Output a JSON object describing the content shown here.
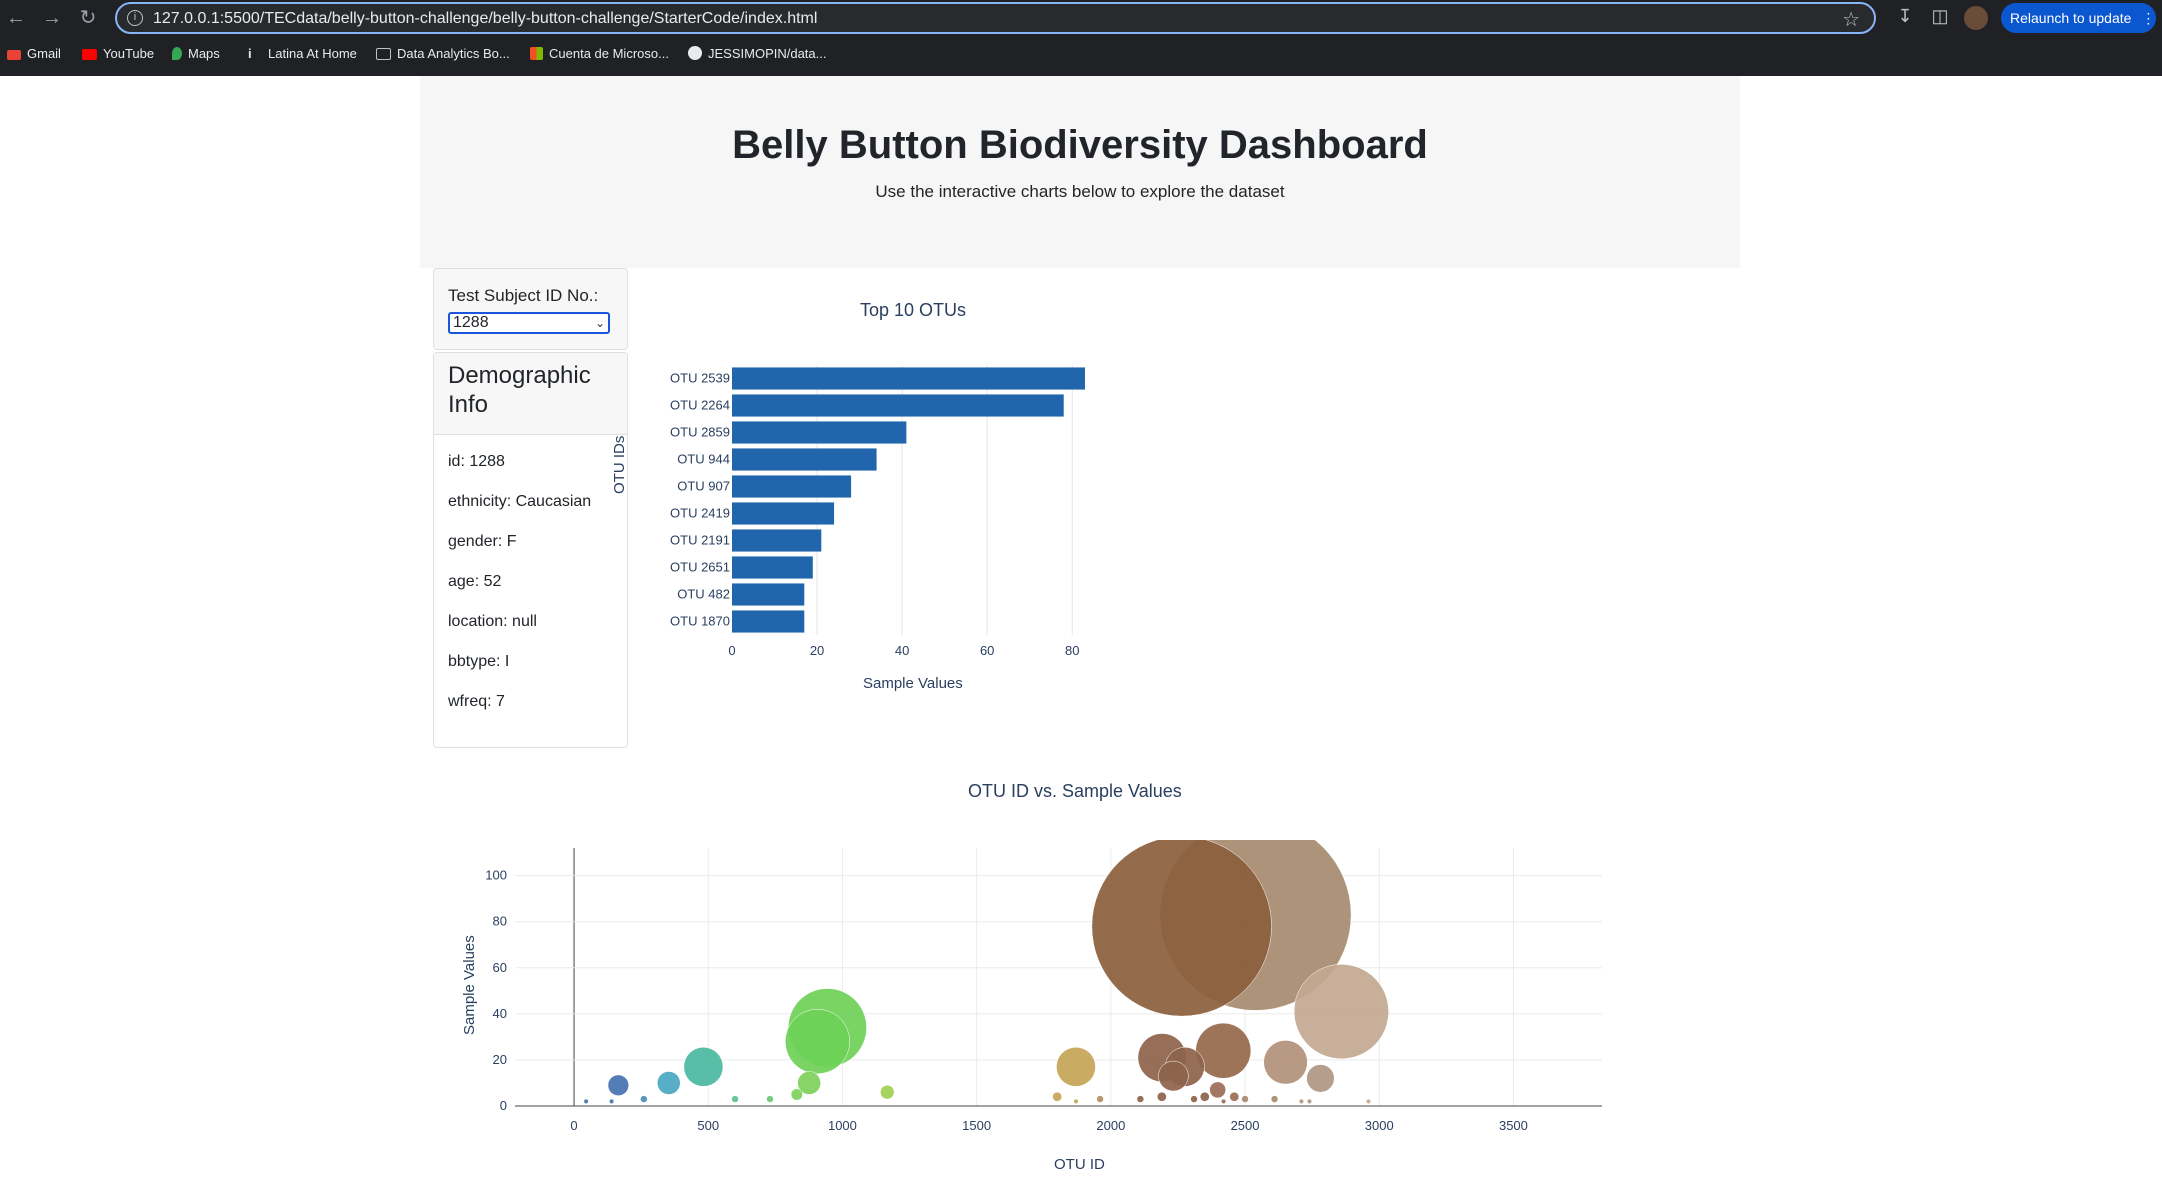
{
  "browser": {
    "url": "127.0.0.1:5500/TECdata/belly-button-challenge/belly-button-challenge/StarterCode/index.html",
    "relaunch_label": "Relaunch to update",
    "bookmarks": [
      "Gmail",
      "YouTube",
      "Maps",
      "Latina At Home",
      "Data Analytics Bo...",
      "Cuenta de Microso...",
      "JESSIMOPIN/data..."
    ]
  },
  "header": {
    "title": "Belly Button Biodiversity Dashboard",
    "subtitle": "Use the interactive charts below to explore the dataset"
  },
  "selector": {
    "label": "Test Subject ID No.:",
    "selected": "1288"
  },
  "demographics": {
    "title": "Demographic Info",
    "lines": [
      "id: 1288",
      "ethnicity: Caucasian",
      "gender: F",
      "age: 52",
      "location: null",
      "bbtype: I",
      "wfreq: 7"
    ]
  },
  "chart_data": [
    {
      "type": "bar",
      "orientation": "horizontal",
      "title": "Top 10 OTUs",
      "xlabel": "Sample Values",
      "ylabel": "OTU IDs",
      "categories": [
        "OTU 2539",
        "OTU 2264",
        "OTU 2859",
        "OTU 944",
        "OTU 907",
        "OTU 2419",
        "OTU 2191",
        "OTU 2651",
        "OTU 482",
        "OTU 1870"
      ],
      "values": [
        83,
        78,
        41,
        34,
        28,
        24,
        21,
        19,
        17,
        17
      ],
      "xlim": [
        0,
        87
      ],
      "xticks": [
        0,
        20,
        40,
        60,
        80
      ],
      "color": "#2166ac",
      "grid": true
    },
    {
      "type": "scatter",
      "mode": "bubble",
      "title": "OTU ID vs. Sample Values",
      "xlabel": "OTU ID",
      "ylabel": "Sample Values",
      "xlim": [
        -220,
        3830
      ],
      "ylim": [
        0,
        112
      ],
      "xticks": [
        0,
        500,
        1000,
        1500,
        2000,
        2500,
        3000,
        3500
      ],
      "yticks": [
        0,
        20,
        40,
        60,
        80,
        100
      ],
      "grid": true,
      "points": [
        {
          "x": 2539,
          "y": 83,
          "color": "#a68a6f"
        },
        {
          "x": 2264,
          "y": 78,
          "color": "#8b5e3c"
        },
        {
          "x": 2859,
          "y": 41,
          "color": "#c2a890"
        },
        {
          "x": 944,
          "y": 34,
          "color": "#6ed057"
        },
        {
          "x": 907,
          "y": 28,
          "color": "#6ed057"
        },
        {
          "x": 2419,
          "y": 24,
          "color": "#96684b"
        },
        {
          "x": 2191,
          "y": 21,
          "color": "#8e634b"
        },
        {
          "x": 2651,
          "y": 19,
          "color": "#b29079"
        },
        {
          "x": 482,
          "y": 17,
          "color": "#4bb9a0"
        },
        {
          "x": 1870,
          "y": 17,
          "color": "#c4a455"
        },
        {
          "x": 2276,
          "y": 17,
          "color": "#8e634b"
        },
        {
          "x": 2233,
          "y": 13,
          "color": "#8e634b"
        },
        {
          "x": 2781,
          "y": 12,
          "color": "#b09682"
        },
        {
          "x": 353,
          "y": 10,
          "color": "#4ba7c2"
        },
        {
          "x": 165,
          "y": 9,
          "color": "#4571b0"
        },
        {
          "x": 876,
          "y": 10,
          "color": "#7ed05a"
        },
        {
          "x": 2398,
          "y": 7,
          "color": "#9b6b55"
        },
        {
          "x": 1167,
          "y": 6,
          "color": "#a0d050"
        },
        {
          "x": 830,
          "y": 5,
          "color": "#7ed05a"
        },
        {
          "x": 2190,
          "y": 4,
          "color": "#8e634b"
        },
        {
          "x": 2350,
          "y": 4,
          "color": "#8e634b"
        },
        {
          "x": 2460,
          "y": 4,
          "color": "#9b6b55"
        },
        {
          "x": 1800,
          "y": 4,
          "color": "#c4a455"
        },
        {
          "x": 1960,
          "y": 3,
          "color": "#b58d5e"
        },
        {
          "x": 2110,
          "y": 3,
          "color": "#8e634b"
        },
        {
          "x": 2310,
          "y": 3,
          "color": "#8e634b"
        },
        {
          "x": 2500,
          "y": 3,
          "color": "#a68a6f"
        },
        {
          "x": 2610,
          "y": 3,
          "color": "#a68a6f"
        },
        {
          "x": 260,
          "y": 3,
          "color": "#4a8fb8"
        },
        {
          "x": 600,
          "y": 3,
          "color": "#5cc290"
        },
        {
          "x": 730,
          "y": 3,
          "color": "#6cc87a"
        },
        {
          "x": 2710,
          "y": 2,
          "color": "#b09682"
        },
        {
          "x": 2740,
          "y": 2,
          "color": "#b09682"
        },
        {
          "x": 45,
          "y": 2,
          "color": "#4571b0"
        },
        {
          "x": 140,
          "y": 2,
          "color": "#4571b0"
        },
        {
          "x": 1870,
          "y": 2,
          "color": "#c4a455"
        },
        {
          "x": 2420,
          "y": 2,
          "color": "#9b6b55"
        },
        {
          "x": 2960,
          "y": 2,
          "color": "#c2a890"
        }
      ]
    }
  ]
}
